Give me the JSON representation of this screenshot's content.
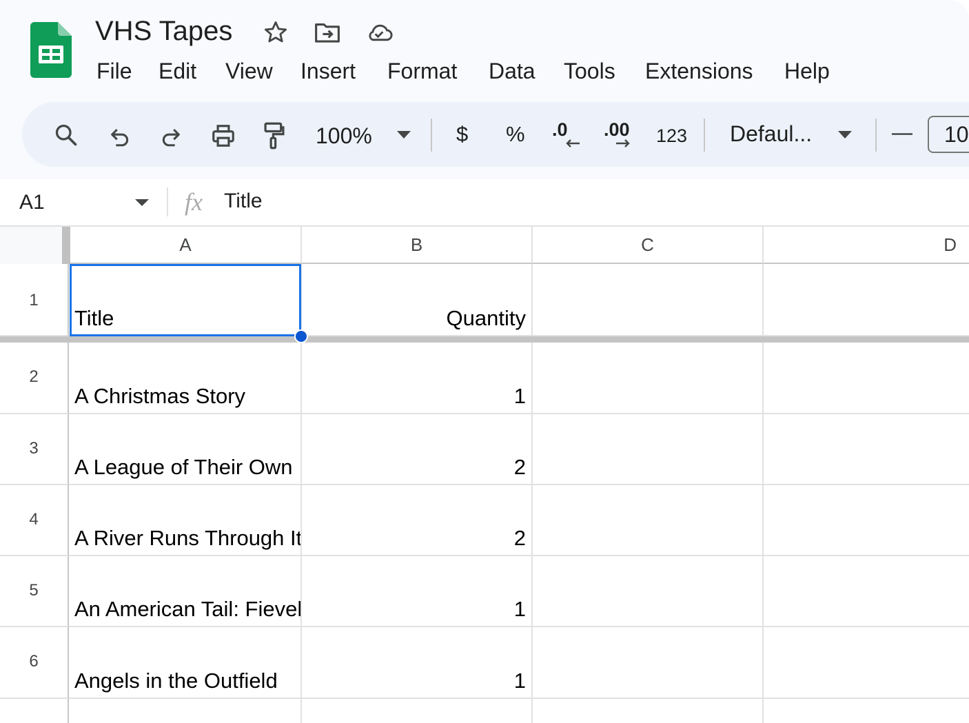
{
  "app": {
    "doc_title": "VHS Tapes",
    "icons": [
      "sheets-logo-icon",
      "star-icon",
      "move-folder-icon",
      "cloud-saved-icon"
    ]
  },
  "menu": {
    "items": [
      "File",
      "Edit",
      "View",
      "Insert",
      "Format",
      "Data",
      "Tools",
      "Extensions",
      "Help"
    ]
  },
  "toolbar": {
    "zoom": "100%",
    "currency": "$",
    "percent": "%",
    "decrease_decimal": ".0",
    "increase_decimal": ".00",
    "number_format": "123",
    "font": "Defaul...",
    "decrease_font_size": "—",
    "font_size": "10",
    "icons": [
      "search-icon",
      "undo-icon",
      "redo-icon",
      "print-icon",
      "paint-format-icon",
      "dropdown-arrow-icon"
    ]
  },
  "formula_bar": {
    "name_box": "A1",
    "fx_label": "fx",
    "value": "Title"
  },
  "sheet": {
    "columns": [
      "A",
      "B",
      "C",
      "D"
    ],
    "rows": [
      "1",
      "2",
      "3",
      "4",
      "5",
      "6"
    ],
    "cells": [
      [
        "Title",
        "Quantity"
      ],
      [
        "A Christmas Story",
        "1"
      ],
      [
        "A League of Their Own",
        "2"
      ],
      [
        "A River Runs Through It",
        "2"
      ],
      [
        "An American Tail: Fievel Goes West",
        "1"
      ],
      [
        "Angels in the Outfield",
        "1"
      ]
    ],
    "selected_cell": "A1",
    "accent_color": "#1a73e8"
  }
}
